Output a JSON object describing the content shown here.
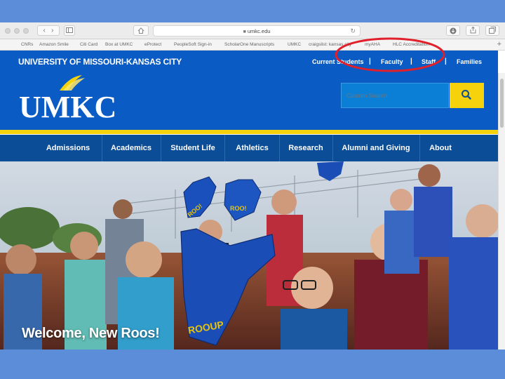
{
  "browser": {
    "url": "umkc.edu",
    "bookmarks": [
      "CNRs",
      "Amazon Smile",
      "Citi Card",
      "Box at UMKC",
      "eProtect",
      "PeopleSoft Sign-in",
      "ScholarOne Manuscripts",
      "UMKC",
      "craigslist: kansas city",
      "myAHA",
      "HLC Accreditation"
    ]
  },
  "header": {
    "university_name": "UNIVERSITY OF MISSOURI-KANSAS CITY",
    "toplinks": [
      "Current Students",
      "Faculty",
      "Staff",
      "Families"
    ],
    "separator": "|",
    "logo_text": "UMKC",
    "search_placeholder": "Custom Search"
  },
  "nav": {
    "items": [
      "Admissions",
      "Academics",
      "Student Life",
      "Athletics",
      "Research",
      "Alumni and Giving",
      "About"
    ]
  },
  "hero": {
    "title": "Welcome, New Roos!",
    "foam_finger_texts": [
      "ROO!",
      "ROO!",
      "ROOUP"
    ]
  },
  "colors": {
    "brand_blue": "#0a5bc4",
    "nav_blue": "#0b4d96",
    "brand_gold": "#f5d20c",
    "annotation": "#e0202a",
    "slide_background": "#5b8dd9"
  }
}
